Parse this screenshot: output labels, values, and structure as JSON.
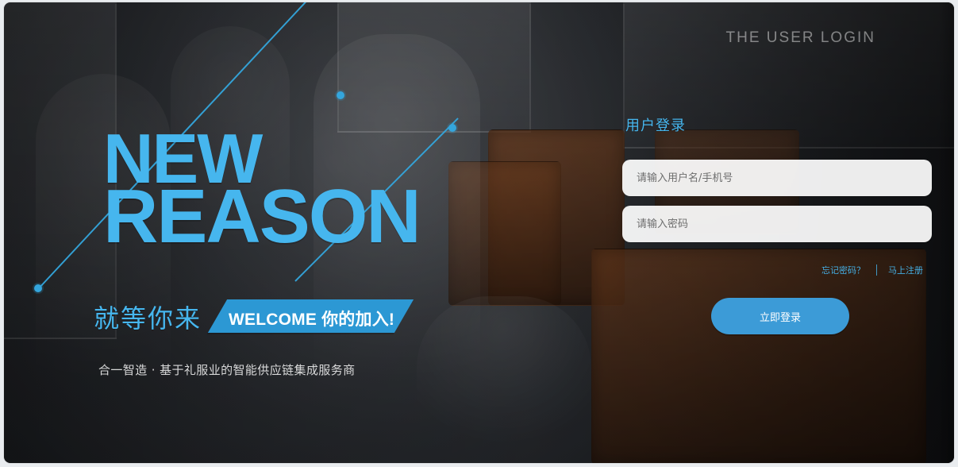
{
  "left": {
    "hero_line1": "NEW",
    "hero_line2": "REASON",
    "cn_title": "就等你来",
    "welcome": "WELCOME 你的加入!",
    "subtitle": "合一智造 · 基于礼服业的智能供应链集成服务商"
  },
  "login": {
    "en_title": "THE USER LOGIN",
    "cn_title": "用户登录",
    "username_placeholder": "请输入用户名/手机号",
    "password_placeholder": "请输入密码",
    "forgot_link": "忘记密码？",
    "register_link": "马上注册",
    "login_button": "立即登录"
  },
  "colors": {
    "accent": "#46b6ee",
    "button": "#3c9bd7"
  }
}
